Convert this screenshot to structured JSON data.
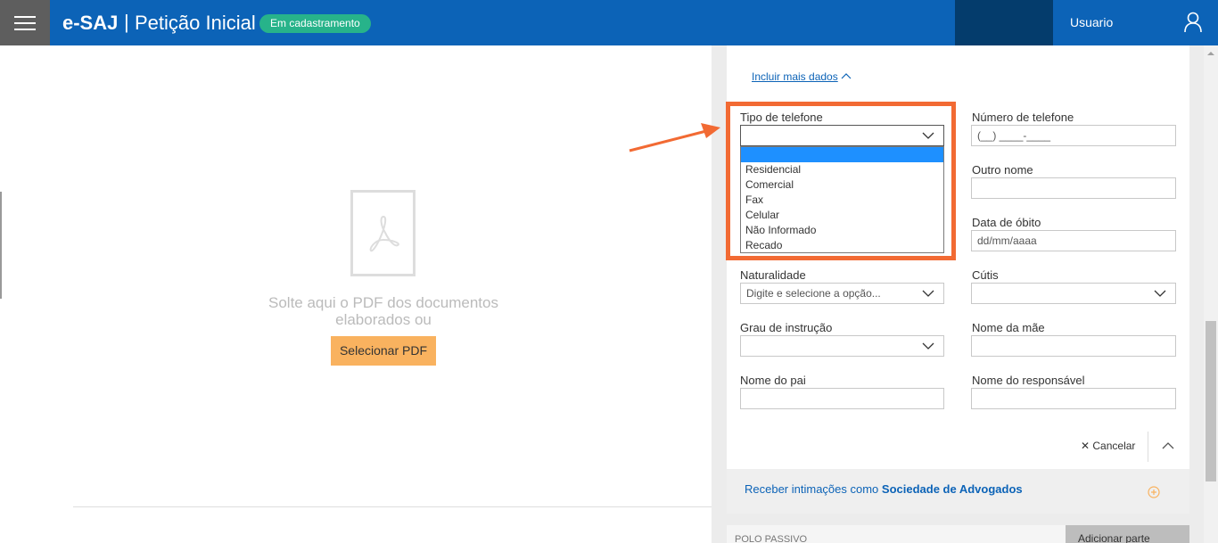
{
  "header": {
    "brand": "e-SAJ",
    "separator": "|",
    "page_title": "Petição Inicial",
    "status_badge": "Em cadastramento",
    "user_label": "Usuario"
  },
  "left_pane": {
    "drop_text_line1": "Solte aqui o PDF dos documentos",
    "drop_text_line2": "elaborados ou",
    "select_pdf_button": "Selecionar PDF"
  },
  "form": {
    "include_more_link": "Incluir mais dados",
    "fields": {
      "tipo_telefone": {
        "label": "Tipo de telefone",
        "value": ""
      },
      "numero_telefone": {
        "label": "Número de telefone",
        "placeholder": "(__) ____-____"
      },
      "outro_nome": {
        "label": "Outro nome",
        "value": ""
      },
      "data_obito": {
        "label": "Data de óbito",
        "placeholder": "dd/mm/aaaa"
      },
      "naturalidade": {
        "label": "Naturalidade",
        "placeholder": "Digite e selecione a opção..."
      },
      "cutis": {
        "label": "Cútis",
        "value": ""
      },
      "grau_instrucao": {
        "label": "Grau de instrução",
        "value": ""
      },
      "nome_mae": {
        "label": "Nome da mãe",
        "value": ""
      },
      "nome_pai": {
        "label": "Nome do pai",
        "value": ""
      },
      "nome_responsavel": {
        "label": "Nome do responsável",
        "value": ""
      }
    },
    "tipo_telefone_options": [
      "",
      "Residencial",
      "Comercial",
      "Fax",
      "Celular",
      "Não Informado",
      "Recado"
    ],
    "cancel_label": "Cancelar"
  },
  "intimacoes": {
    "prefix": "Receber intimações como ",
    "bold": "Sociedade de Advogados"
  },
  "polo_passivo": {
    "label": "POLO PASSIVO",
    "add_button": "Adicionar parte"
  },
  "colors": {
    "header_blue": "#0c63b7",
    "badge_green": "#27b38a",
    "highlight_orange": "#f26a33",
    "button_orange": "#f9b25f",
    "selected_option": "#1e90ff"
  }
}
